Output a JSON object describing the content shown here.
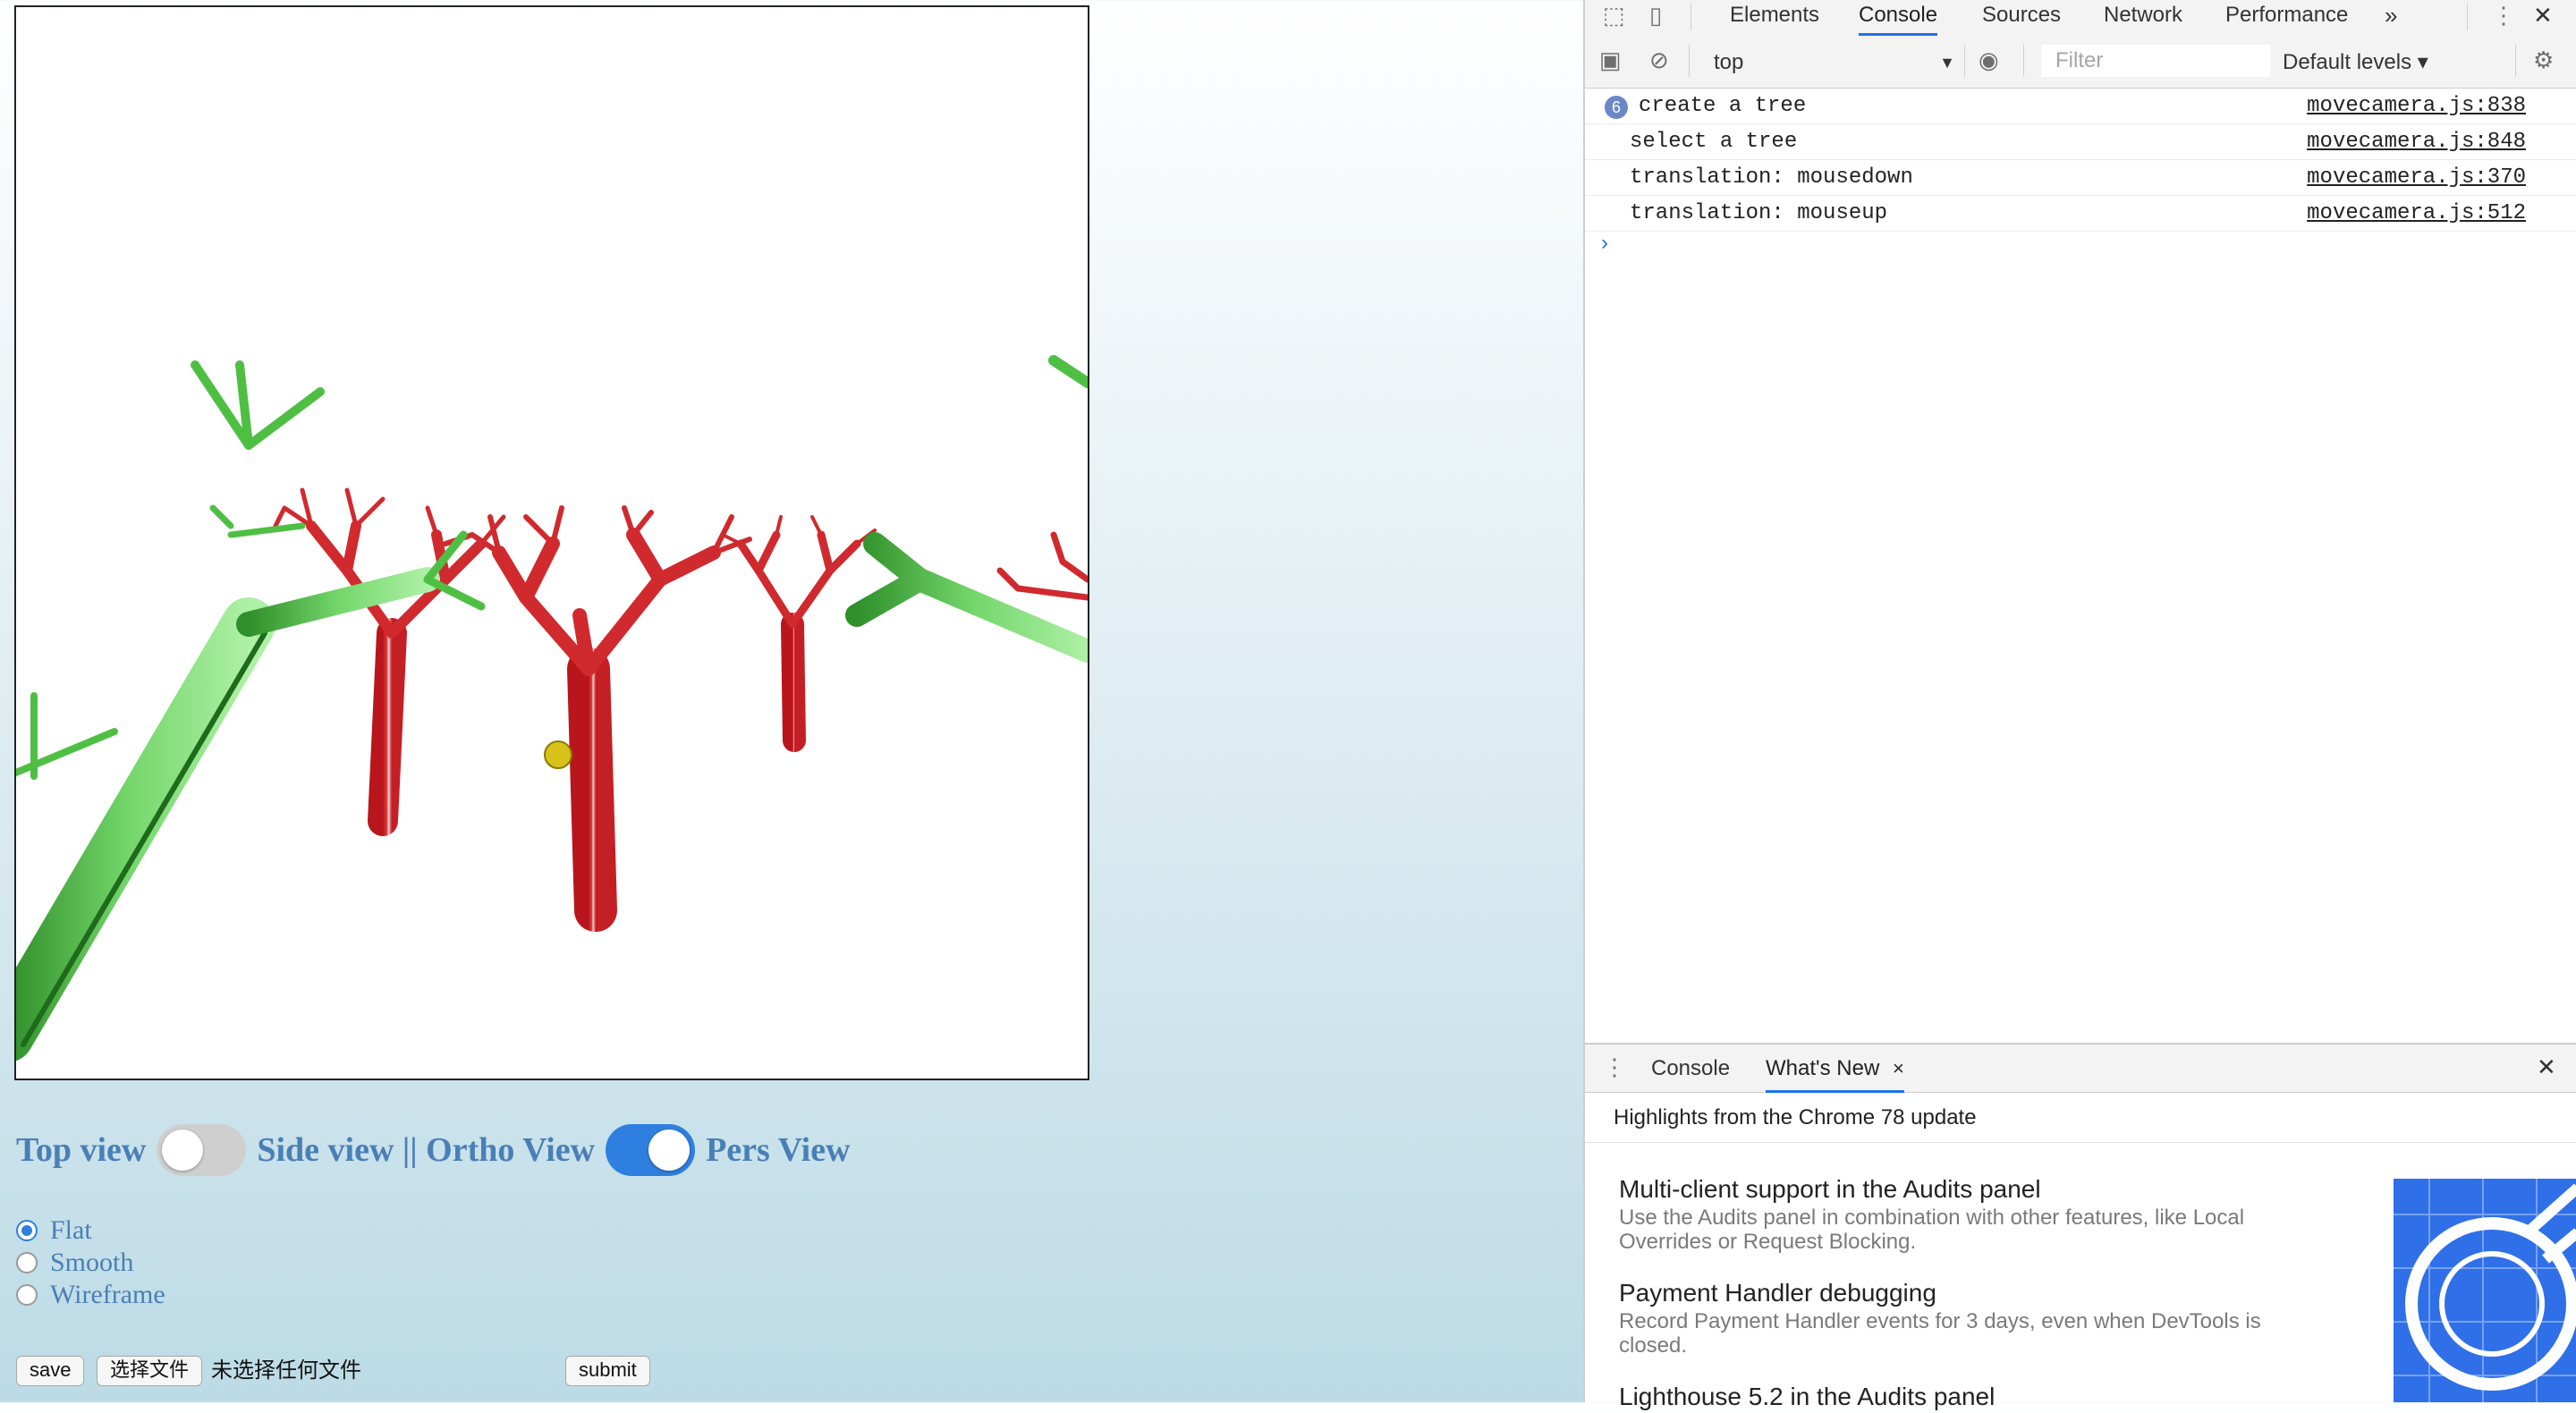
{
  "page": {
    "view_row": {
      "top_view": "Top view",
      "side_ortho": "Side view || Ortho View",
      "pers_view": "Pers View",
      "toggle1_on": false,
      "toggle2_on": true
    },
    "shading": {
      "options": [
        "Flat",
        "Smooth",
        "Wireframe"
      ],
      "selected": "Flat"
    },
    "buttons": {
      "save": "save",
      "choose_file": "选择文件",
      "no_file": "未选择任何文件",
      "submit": "submit"
    }
  },
  "devtools": {
    "tabs": [
      "Elements",
      "Console",
      "Sources",
      "Network",
      "Performance"
    ],
    "active_tab": "Console",
    "more_tabs": "»",
    "context": "top",
    "filter_placeholder": "Filter",
    "levels": "Default levels ▾",
    "messages": [
      {
        "count": "6",
        "text": "create a tree",
        "source": "movecamera.js:838"
      },
      {
        "count": "",
        "text": "select a tree",
        "source": "movecamera.js:848"
      },
      {
        "count": "",
        "text": "translation: mousedown",
        "source": "movecamera.js:370"
      },
      {
        "count": "",
        "text": "translation: mouseup",
        "source": "movecamera.js:512"
      }
    ],
    "prompt": "›",
    "drawer": {
      "tabs": [
        "Console",
        "What's New"
      ],
      "active_tab": "What's New",
      "tab_close": "×",
      "close": "✕",
      "subheading": "Highlights from the Chrome 78 update",
      "items": [
        {
          "title": "Multi-client support in the Audits panel",
          "desc": "Use the Audits panel in combination with other features, like Local Overrides or Request Blocking."
        },
        {
          "title": "Payment Handler debugging",
          "desc": "Record Payment Handler events for 3 days, even when DevTools is closed."
        },
        {
          "title": "Lighthouse 5.2 in the Audits panel",
          "desc": ""
        }
      ]
    },
    "colors": {
      "accent": "#1a73e8",
      "badge": "#6b87c7"
    }
  }
}
